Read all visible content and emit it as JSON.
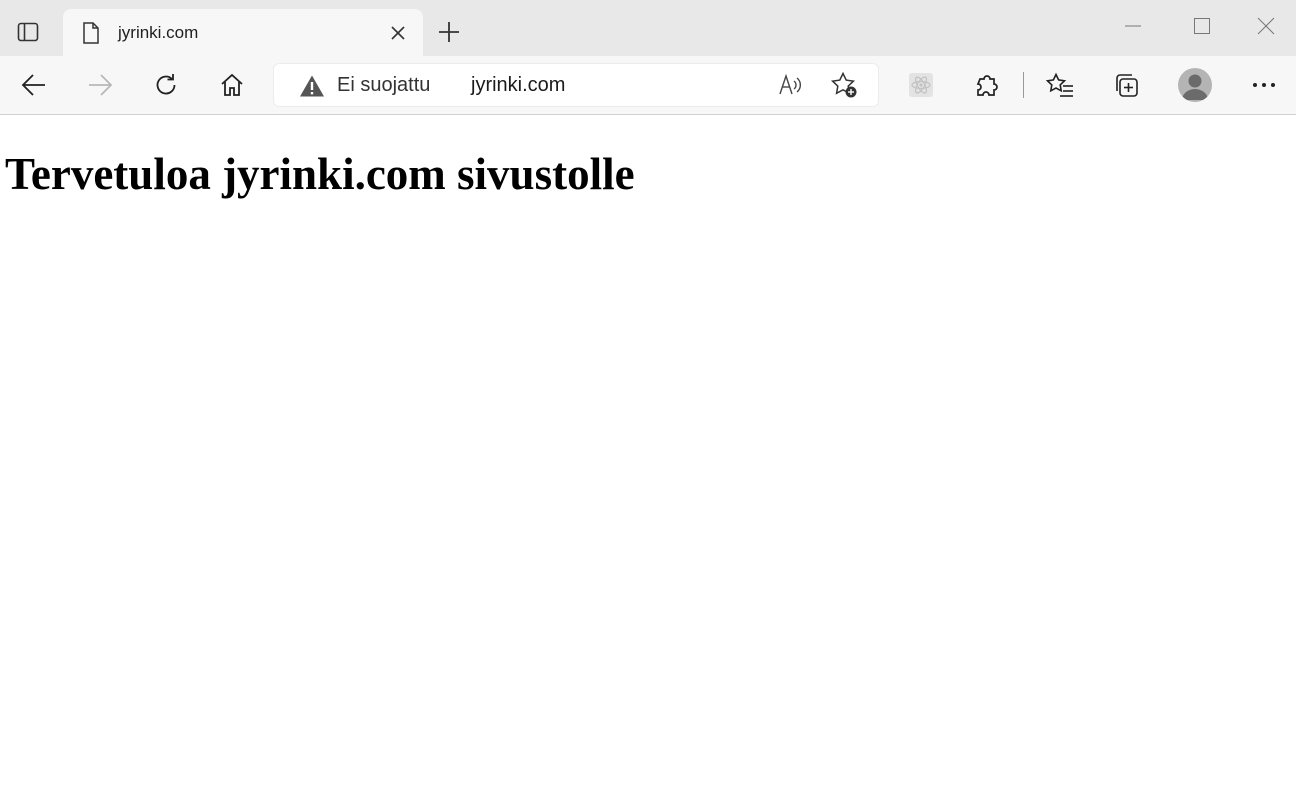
{
  "browser": {
    "tab": {
      "title": "jyrinki.com",
      "icon": "page-icon"
    },
    "address_bar": {
      "security_status": "Ei suojattu",
      "url": "jyrinki.com"
    },
    "toolbar_icons": [
      "back-icon",
      "forward-icon",
      "refresh-icon",
      "home-icon",
      "read-aloud-icon",
      "add-favorite-icon",
      "extension-icon",
      "extensions-icon",
      "favorites-icon",
      "collections-icon",
      "profile-icon",
      "more-icon"
    ],
    "window_controls": [
      "minimize-icon",
      "maximize-icon",
      "close-icon"
    ]
  },
  "page": {
    "heading": "Tervetuloa jyrinki.com sivustolle"
  }
}
